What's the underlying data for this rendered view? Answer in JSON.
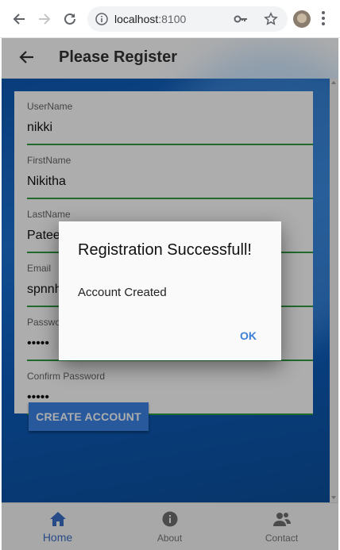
{
  "browser": {
    "host": "localhost",
    "port": ":8100"
  },
  "header": {
    "title": "Please Register"
  },
  "form": {
    "fields": [
      {
        "label": "UserName",
        "value": "nikki"
      },
      {
        "label": "FirstName",
        "value": "Nikitha"
      },
      {
        "label": "LastName",
        "value": "Pateel"
      },
      {
        "label": "Email",
        "value": "spnnh"
      },
      {
        "label": "Password",
        "value": "•••••"
      },
      {
        "label": "Confirm Password",
        "value": "•••••"
      }
    ],
    "submit_label": "CREATE ACCOUNT"
  },
  "tabs": [
    {
      "label": "Home",
      "icon": "home-icon",
      "active": true
    },
    {
      "label": "About",
      "icon": "info-icon",
      "active": false
    },
    {
      "label": "Contact",
      "icon": "contacts-icon",
      "active": false
    }
  ],
  "dialog": {
    "title": "Registration Successfull!",
    "message": "Account Created",
    "ok_label": "OK"
  },
  "colors": {
    "accent": "#3a84e6",
    "field_underline": "#2e9c43",
    "background_blue": "#1c72d4",
    "active_tab": "#3a6fc7"
  }
}
